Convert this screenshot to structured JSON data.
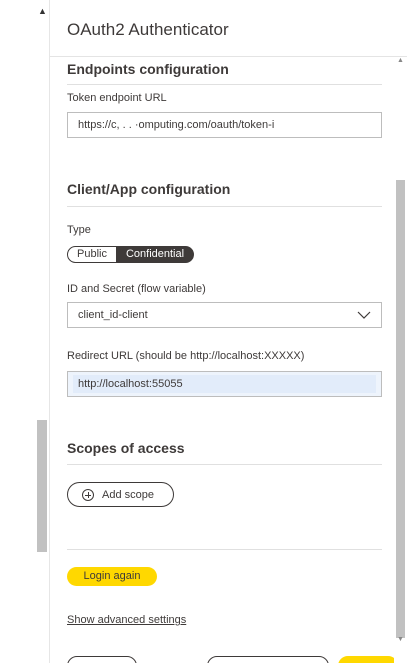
{
  "panel": {
    "title": "OAuth2 Authenticator"
  },
  "endpoints": {
    "section_title": "Endpoints configuration",
    "token_label": "Token endpoint URL",
    "token_value": "https://c,               .                    . ·omputing.com/oauth/token-i"
  },
  "client": {
    "section_title": "Client/App configuration",
    "type_label": "Type",
    "type_options": [
      "Public",
      "Confidential"
    ],
    "type_selected": "Confidential",
    "id_secret_label": "ID and Secret (flow variable)",
    "id_secret_value": "client_id-client",
    "redirect_label": "Redirect URL (should be http://localhost:XXXXX)",
    "redirect_value": "http://localhost:55055"
  },
  "scopes": {
    "section_title": "Scopes of access",
    "add_label": "Add scope"
  },
  "actions": {
    "login_label": "Login again",
    "advanced_label": "Show advanced settings"
  },
  "colors": {
    "accent": "#ffd800",
    "text": "#3e3a39",
    "selected_toggle": "#3e3a39",
    "input_highlight": "#e2ecfa"
  }
}
